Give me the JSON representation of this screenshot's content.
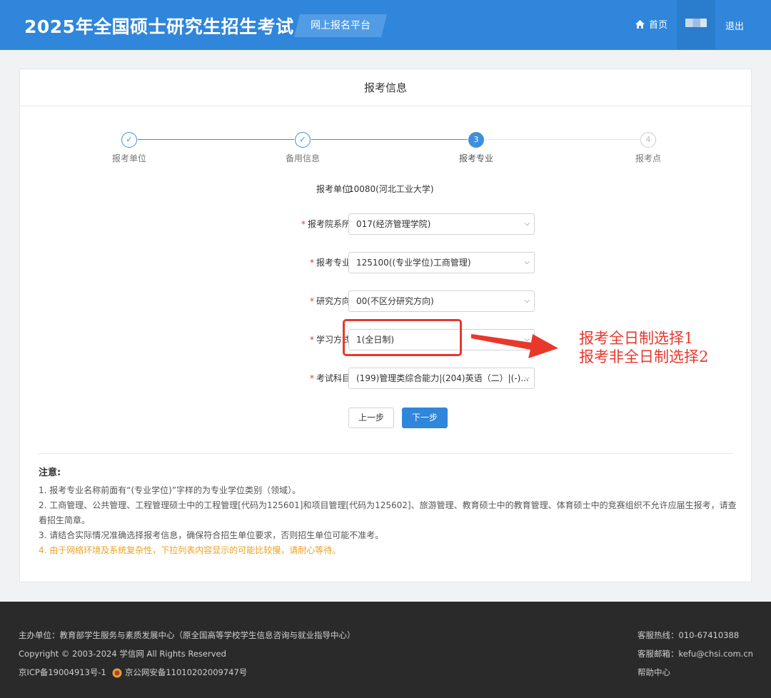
{
  "header": {
    "title": "2025年全国硕士研究生招生考试",
    "platform": "网上报名平台",
    "home_label": "首页",
    "logout_label": "退出"
  },
  "card": {
    "title": "报考信息"
  },
  "steps": [
    {
      "label": "报考单位",
      "status": "done",
      "mark": "✓"
    },
    {
      "label": "备用信息",
      "status": "done",
      "mark": "✓"
    },
    {
      "label": "报考专业",
      "status": "current",
      "mark": "3"
    },
    {
      "label": "报考点",
      "status": "todo",
      "mark": "4"
    }
  ],
  "form": {
    "unit": {
      "label": "报考单位:",
      "value": "10080(河北工业大学)"
    },
    "department": {
      "label": "报考院系所:",
      "value": "017(经济管理学院)"
    },
    "major": {
      "label": "报考专业:",
      "value": "125100((专业学位)工商管理)"
    },
    "direction": {
      "label": "研究方向:",
      "value": "00(不区分研究方向)"
    },
    "study_mode": {
      "label": "学习方式:",
      "value": "1(全日制)"
    },
    "subjects": {
      "label": "考试科目:",
      "value": "(199)管理类综合能力|(204)英语（二）|(-)..."
    },
    "required_mark": "*",
    "prev_label": "上一步",
    "next_label": "下一步"
  },
  "notes": {
    "title": "注意:",
    "items": [
      "1. 报考专业名称前面有“(专业学位)”字样的为专业学位类别（领域）。",
      "2. 工商管理、公共管理、工程管理硕士中的工程管理[代码为125601]和项目管理[代码为125602]、旅游管理、教育硕士中的教育管理、体育硕士中的竞赛组织不允许应届生报考，请查看招生简章。",
      "3. 请结合实际情况准确选择报考信息，确保符合招生单位要求，否则招生单位可能不准考。",
      "4. 由于网络环境及系统复杂性，下拉列表内容显示的可能比较慢，请耐心等待。"
    ]
  },
  "annotation": {
    "line1": "报考全日制选择1",
    "line2": "报考非全日制选择2",
    "color": "#e8382c"
  },
  "footer": {
    "sponsor": "主办单位：教育部学生服务与素质发展中心（原全国高等学校学生信息咨询与就业指导中心）",
    "copyright": "Copyright © 2003-2024 学信网 All Rights Reserved",
    "icp": "京ICP备19004913号-1",
    "police": "京公网安备11010202009747号",
    "hotline": "客服热线：010-67410388",
    "email": "客服邮箱：kefu@chsi.com.cn",
    "help": "帮助中心"
  },
  "colors": {
    "primary": "#2f86db",
    "footer_bg": "#2a2a2a",
    "warn": "#f0a020"
  }
}
